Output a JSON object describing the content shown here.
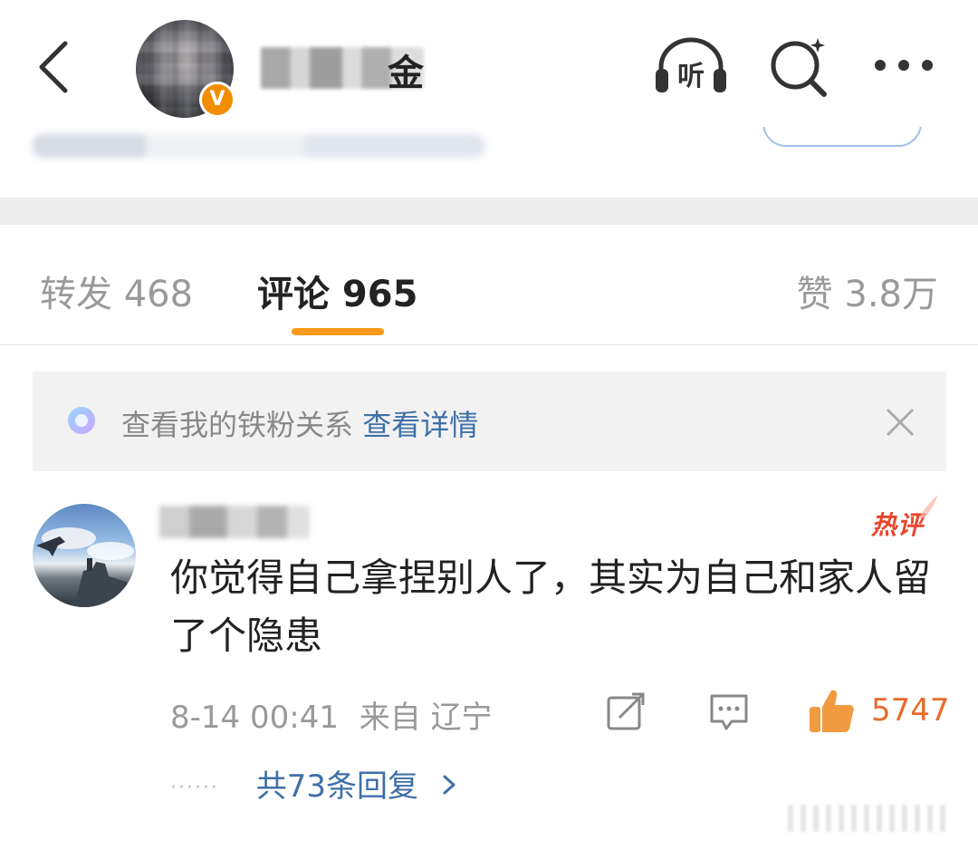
{
  "header": {
    "name_visible_fragment": "金",
    "verified_mark": "V",
    "listen_label": "听"
  },
  "tabs": [
    {
      "label": "转发 468"
    },
    {
      "label": "评论 965"
    },
    {
      "label": "赞 3.8万"
    }
  ],
  "banner": {
    "text": "查看我的铁粉关系",
    "link": "查看详情"
  },
  "comment": {
    "hot_label": "热评",
    "text": "你觉得自己拿捏别人了，其实为自己和家人留了个隐患",
    "time": "8-14 00:41",
    "location": "来自 辽宁",
    "likes": "5747",
    "replies_link": "共73条回复",
    "replies_dots": "······"
  },
  "colors": {
    "accent_orange": "#f99a1c",
    "link_blue": "#3f6fa8",
    "hot_red": "#e8462b",
    "like_orange": "#e86a2b"
  },
  "icons": [
    "back-icon",
    "listen-icon",
    "search-icon",
    "more-icon",
    "sparkle-icon",
    "close-icon",
    "share-icon",
    "reply-icon",
    "like-icon",
    "chevron-right-icon"
  ]
}
